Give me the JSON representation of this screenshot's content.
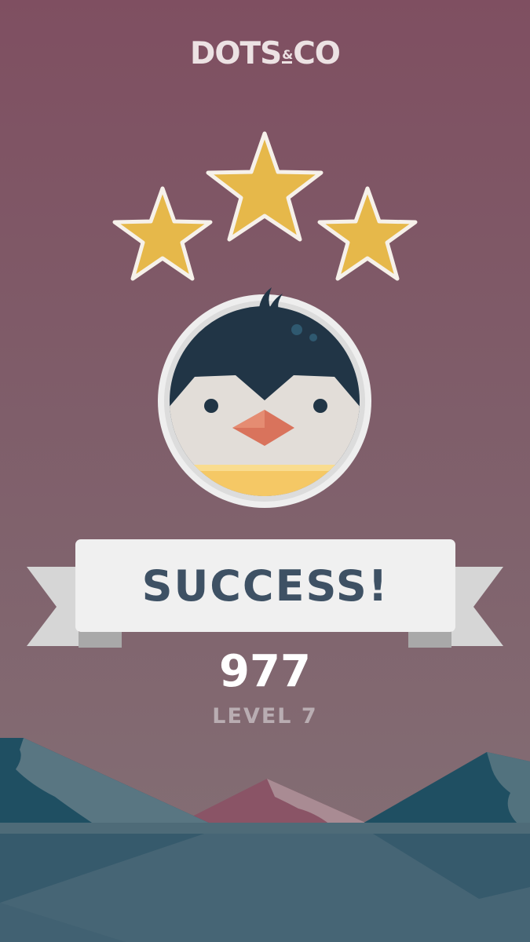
{
  "game": {
    "logo": {
      "text_left": "DOTS",
      "text_amp": "&",
      "text_right": "CO"
    },
    "stars": {
      "earned": 3,
      "total": 3,
      "color": "#e6b84a"
    },
    "character": {
      "name_icon": "penguin-icon"
    },
    "result": {
      "banner_text": "SUCCESS!",
      "score": "977",
      "level_label": "LEVEL 7"
    },
    "colors": {
      "background_top": "#7f4f61",
      "banner_text": "#3e5164",
      "penguin_head": "#213546",
      "penguin_beak": "#d9735c",
      "penguin_collar": "#f5c865"
    }
  }
}
